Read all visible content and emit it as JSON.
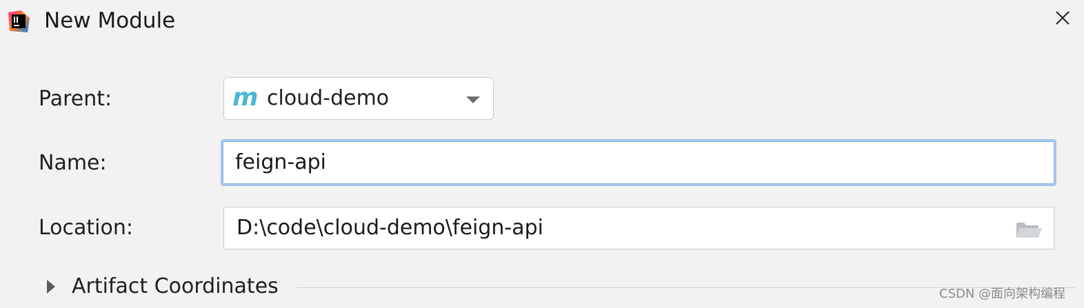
{
  "window": {
    "title": "New Module",
    "app_icon": "intellij-idea-icon",
    "close_icon": "close-icon"
  },
  "form": {
    "parent": {
      "label": "Parent:",
      "icon": "maven-module-icon",
      "icon_glyph": "m",
      "value": "cloud-demo"
    },
    "name": {
      "label": "Name:",
      "value": "feign-api"
    },
    "location": {
      "label": "Location:",
      "value": "D:\\code\\cloud-demo\\feign-api",
      "browse_icon": "folder-icon"
    }
  },
  "artifact_section": {
    "label": "Artifact Coordinates",
    "expanded": false
  },
  "watermark": "CSDN @面向架构编程",
  "colors": {
    "background": "#f2f2f2",
    "focus_border": "#a6c5ea",
    "maven_icon": "#4bb8d4"
  }
}
